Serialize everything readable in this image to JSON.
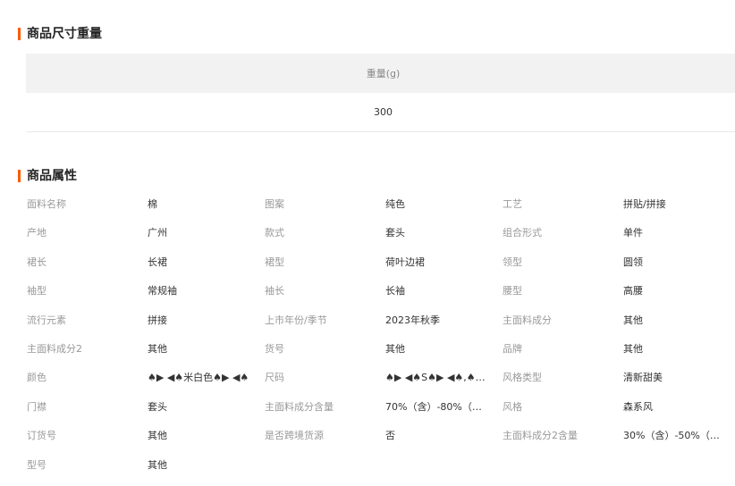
{
  "size_section": {
    "title": "商品尺寸重量",
    "header": "重量(g)",
    "value": "300"
  },
  "attr_section": {
    "title": "商品属性",
    "rows": [
      [
        {
          "label": "面料名称",
          "value": "棉"
        },
        {
          "label": "图案",
          "value": "纯色"
        },
        {
          "label": "工艺",
          "value": "拼贴/拼接"
        }
      ],
      [
        {
          "label": "产地",
          "value": "广州"
        },
        {
          "label": "款式",
          "value": "套头"
        },
        {
          "label": "组合形式",
          "value": "单件"
        }
      ],
      [
        {
          "label": "裙长",
          "value": "长裙"
        },
        {
          "label": "裙型",
          "value": "荷叶边裙"
        },
        {
          "label": "领型",
          "value": "圆领"
        }
      ],
      [
        {
          "label": "袖型",
          "value": "常规袖"
        },
        {
          "label": "袖长",
          "value": "长袖"
        },
        {
          "label": "腰型",
          "value": "高腰"
        }
      ],
      [
        {
          "label": "流行元素",
          "value": "拼接"
        },
        {
          "label": "上市年份/季节",
          "value": "2023年秋季"
        },
        {
          "label": "主面料成分",
          "value": "其他"
        }
      ],
      [
        {
          "label": "主面料成分2",
          "value": "其他"
        },
        {
          "label": "货号",
          "value": "其他"
        },
        {
          "label": "品牌",
          "value": "其他"
        }
      ],
      [
        {
          "label": "颜色",
          "value": "♠▶ ◀♠米白色♠▶ ◀♠"
        },
        {
          "label": "尺码",
          "value": "♠▶ ◀♠S♠▶ ◀♠,♠▶ ◀♠..."
        },
        {
          "label": "风格类型",
          "value": "清新甜美"
        }
      ],
      [
        {
          "label": "门襟",
          "value": "套头"
        },
        {
          "label": "主面料成分含量",
          "value": "70%（含）-80%（不..."
        },
        {
          "label": "风格",
          "value": "森系风"
        }
      ],
      [
        {
          "label": "订货号",
          "value": "其他"
        },
        {
          "label": "是否跨境货源",
          "value": "否"
        },
        {
          "label": "主面料成分2含量",
          "value": "30%（含）-50%（不..."
        }
      ],
      [
        {
          "label": "型号",
          "value": "其他"
        }
      ]
    ]
  }
}
